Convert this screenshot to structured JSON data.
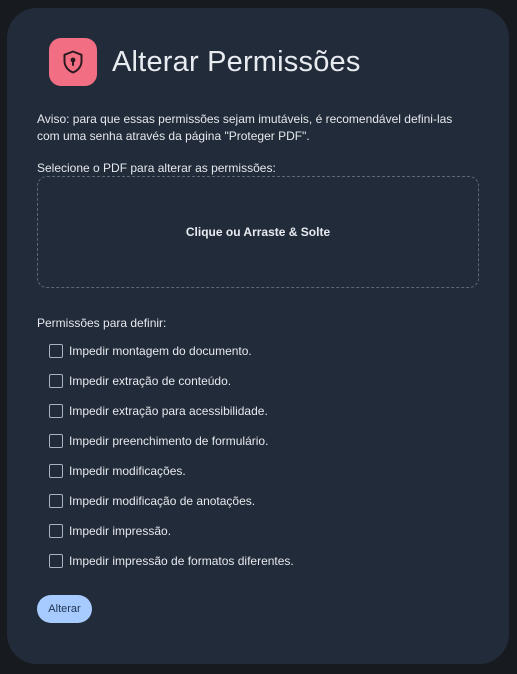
{
  "header": {
    "icon": "shield-lock-icon",
    "title": "Alterar Permissões"
  },
  "notice": "Aviso: para que essas permissões sejam imutáveis, é recomendável defini-las com uma senha através da página \"Proteger PDF\".",
  "file_select": {
    "label": "Selecione o PDF para alterar as permissões:",
    "dropzone_text": "Clique ou Arraste & Solte"
  },
  "permissions": {
    "label": "Permissões para definir:",
    "items": [
      {
        "label": "Impedir montagem do documento.",
        "checked": false
      },
      {
        "label": "Impedir extração de conteúdo.",
        "checked": false
      },
      {
        "label": "Impedir extração para acessibilidade.",
        "checked": false
      },
      {
        "label": "Impedir preenchimento de formulário.",
        "checked": false
      },
      {
        "label": "Impedir modificações.",
        "checked": false
      },
      {
        "label": "Impedir modificação de anotações.",
        "checked": false
      },
      {
        "label": "Impedir impressão.",
        "checked": false
      },
      {
        "label": "Impedir impressão de formatos diferentes.",
        "checked": false
      }
    ]
  },
  "submit_label": "Alterar",
  "colors": {
    "page_bg": "#171b20",
    "card_bg": "#222b39",
    "icon_bg": "#f26f83",
    "button_bg": "#a8cbff"
  }
}
